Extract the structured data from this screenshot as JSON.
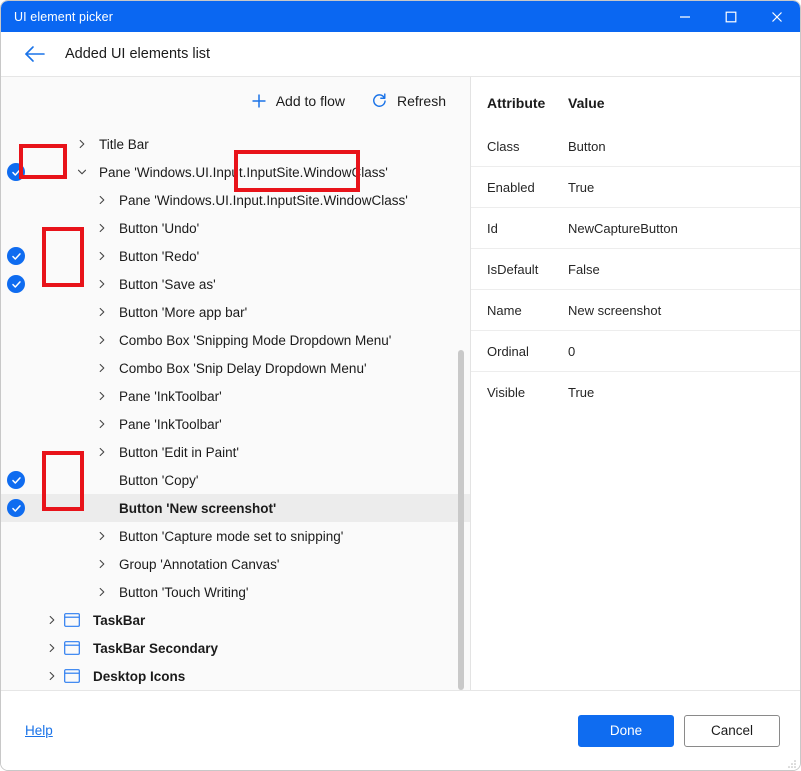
{
  "window": {
    "title": "UI element picker",
    "controls": {
      "minimize": "minimize-icon",
      "maximize": "maximize-icon",
      "close": "close-icon"
    }
  },
  "header": {
    "back_icon": "arrow-left-icon",
    "page_title": "Added UI elements list"
  },
  "toolbar": {
    "add_to_flow_label": "Add to flow",
    "add_to_flow_icon": "plus-icon",
    "refresh_label": "Refresh",
    "refresh_icon": "refresh-icon"
  },
  "tree": {
    "items": [
      {
        "label": "Title Bar",
        "indent": 1,
        "chevron": "collapsed",
        "checked": false,
        "bold": false,
        "icon": null,
        "selected": false
      },
      {
        "label": "Pane 'Windows.UI.Input.InputSite.WindowClass'",
        "indent": 1,
        "chevron": "expanded",
        "checked": true,
        "bold": false,
        "icon": null,
        "selected": false
      },
      {
        "label": "Pane 'Windows.UI.Input.InputSite.WindowClass'",
        "indent": 2,
        "chevron": "collapsed",
        "checked": false,
        "bold": false,
        "icon": null,
        "selected": false
      },
      {
        "label": "Button 'Undo'",
        "indent": 2,
        "chevron": "collapsed",
        "checked": false,
        "bold": false,
        "icon": null,
        "selected": false
      },
      {
        "label": "Button 'Redo'",
        "indent": 2,
        "chevron": "collapsed",
        "checked": true,
        "bold": false,
        "icon": null,
        "selected": false
      },
      {
        "label": "Button 'Save as'",
        "indent": 2,
        "chevron": "collapsed",
        "checked": true,
        "bold": false,
        "icon": null,
        "selected": false
      },
      {
        "label": "Button 'More app bar'",
        "indent": 2,
        "chevron": "collapsed",
        "checked": false,
        "bold": false,
        "icon": null,
        "selected": false
      },
      {
        "label": "Combo Box 'Snipping Mode Dropdown Menu'",
        "indent": 2,
        "chevron": "collapsed",
        "checked": false,
        "bold": false,
        "icon": null,
        "selected": false
      },
      {
        "label": "Combo Box 'Snip Delay Dropdown Menu'",
        "indent": 2,
        "chevron": "collapsed",
        "checked": false,
        "bold": false,
        "icon": null,
        "selected": false
      },
      {
        "label": "Pane 'InkToolbar'",
        "indent": 2,
        "chevron": "collapsed",
        "checked": false,
        "bold": false,
        "icon": null,
        "selected": false
      },
      {
        "label": "Pane 'InkToolbar'",
        "indent": 2,
        "chevron": "collapsed",
        "checked": false,
        "bold": false,
        "icon": null,
        "selected": false
      },
      {
        "label": "Button 'Edit in Paint'",
        "indent": 2,
        "chevron": "collapsed",
        "checked": false,
        "bold": false,
        "icon": null,
        "selected": false
      },
      {
        "label": "Button 'Copy'",
        "indent": 2,
        "chevron": "none",
        "checked": true,
        "bold": false,
        "icon": null,
        "selected": false
      },
      {
        "label": "Button 'New screenshot'",
        "indent": 2,
        "chevron": "none",
        "checked": true,
        "bold": true,
        "icon": null,
        "selected": true
      },
      {
        "label": "Button 'Capture mode set to snipping'",
        "indent": 2,
        "chevron": "collapsed",
        "checked": false,
        "bold": false,
        "icon": null,
        "selected": false
      },
      {
        "label": "Group 'Annotation Canvas'",
        "indent": 2,
        "chevron": "collapsed",
        "checked": false,
        "bold": false,
        "icon": null,
        "selected": false
      },
      {
        "label": "Button 'Touch Writing'",
        "indent": 2,
        "chevron": "collapsed",
        "checked": false,
        "bold": false,
        "icon": null,
        "selected": false
      },
      {
        "label": "TaskBar",
        "indent": 0,
        "chevron": "collapsed",
        "checked": false,
        "bold": true,
        "icon": "window-icon",
        "selected": false
      },
      {
        "label": "TaskBar Secondary",
        "indent": 0,
        "chevron": "collapsed",
        "checked": false,
        "bold": true,
        "icon": "window-icon",
        "selected": false
      },
      {
        "label": "Desktop Icons",
        "indent": 0,
        "chevron": "collapsed",
        "checked": false,
        "bold": true,
        "icon": "window-icon",
        "selected": false
      }
    ]
  },
  "attributes": {
    "columns": [
      "Attribute",
      "Value"
    ],
    "rows": [
      {
        "attribute": "Class",
        "value": "Button"
      },
      {
        "attribute": "Enabled",
        "value": "True"
      },
      {
        "attribute": "Id",
        "value": "NewCaptureButton"
      },
      {
        "attribute": "IsDefault",
        "value": "False"
      },
      {
        "attribute": "Name",
        "value": "New screenshot"
      },
      {
        "attribute": "Ordinal",
        "value": "0"
      },
      {
        "attribute": "Visible",
        "value": "True"
      }
    ]
  },
  "footer": {
    "help_label": "Help",
    "done_label": "Done",
    "cancel_label": "Cancel"
  },
  "colors": {
    "titlebar_blue": "#0a67f2",
    "accent_blue": "#0f6cf0",
    "link_blue": "#1a73e8",
    "annotation_red": "#e8131a",
    "selected_row": "#ececec",
    "left_pane_bg": "#fafafa"
  }
}
